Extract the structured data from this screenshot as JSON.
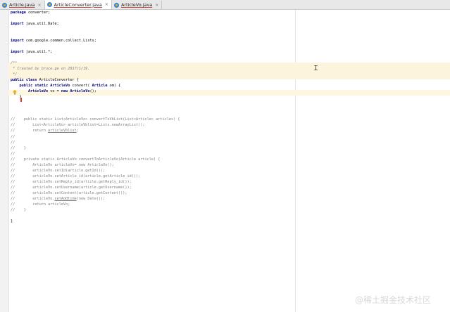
{
  "tabs": [
    {
      "label": "Article.java",
      "close": "×",
      "active": false
    },
    {
      "label": "ArticleConverter.java",
      "close": "×",
      "active": true
    },
    {
      "label": "ArticleVo.java",
      "close": "×",
      "active": false
    }
  ],
  "code": [
    [
      {
        "t": "package ",
        "c": "kw"
      },
      {
        "t": "converter;"
      }
    ],
    [],
    [
      {
        "t": "import ",
        "c": "kw"
      },
      {
        "t": "java.util.Date;"
      }
    ],
    [],
    [],
    [
      {
        "t": "import ",
        "c": "kw"
      },
      {
        "t": "com.google.common.collect.Lists;"
      }
    ],
    [],
    [
      {
        "t": "import ",
        "c": "kw"
      },
      {
        "t": "java.util.*;"
      }
    ],
    [],
    [
      {
        "t": "/**",
        "c": "ci"
      }
    ],
    [
      {
        "t": " * Created by bruce.ge on 2017/1/19.",
        "c": "ci"
      }
    ],
    [
      {
        "t": " */",
        "c": "ci"
      }
    ],
    [
      {
        "t": "public class ",
        "c": "kw"
      },
      {
        "t": "ArticleConverter {"
      }
    ],
    [
      {
        "t": "    "
      },
      {
        "t": "public static ",
        "c": "kw"
      },
      {
        "t": "ArticleVo ",
        "c": "kw"
      },
      {
        "t": "convert( "
      },
      {
        "t": "Article ",
        "c": "kw"
      },
      {
        "t": "om) {"
      }
    ],
    [
      {
        "t": "        "
      },
      {
        "t": "ArticleVo ",
        "c": "kw"
      },
      {
        "t": "vo = "
      },
      {
        "t": "new ",
        "c": "kw"
      },
      {
        "t": "ArticleVo",
        "c": "kw"
      },
      {
        "t": "();"
      }
    ],
    [
      {
        "t": "    }"
      }
    ],
    [],
    [],
    [],
    [
      {
        "t": "//    public static List<ArticleVo> convertToVbList(List<Article> articles) {",
        "c": "cm"
      }
    ],
    [
      {
        "t": "//        List<ArticleVo> articleVblist=Lists.newArrayList();",
        "c": "cm"
      }
    ],
    [
      {
        "t": "//        return ",
        "c": "cm"
      },
      {
        "t": "articleVblist",
        "c": "cm ul"
      },
      {
        "t": ";",
        "c": "cm"
      }
    ],
    [
      {
        "t": "//",
        "c": "cm"
      }
    ],
    [
      {
        "t": "//",
        "c": "cm"
      }
    ],
    [
      {
        "t": "//    }",
        "c": "cm"
      }
    ],
    [
      {
        "t": "//",
        "c": "cm"
      }
    ],
    [
      {
        "t": "//    private static ArticleVo convertToArticleVo(Article article) {",
        "c": "cm"
      }
    ],
    [
      {
        "t": "//        ArticleVo articleVo= new ArticleVo();",
        "c": "cm"
      }
    ],
    [
      {
        "t": "//        articleVo.setId(article.getId());",
        "c": "cm"
      }
    ],
    [
      {
        "t": "//        articleVo.setArticle_id(article.getArticle_id());",
        "c": "cm"
      }
    ],
    [
      {
        "t": "//        articleVo.setReply_id(article.getReply_id());",
        "c": "cm"
      }
    ],
    [
      {
        "t": "//        articleVo.setUsername(article.getUsername());",
        "c": "cm"
      }
    ],
    [
      {
        "t": "//        articleVo.setContent(article.getContent());",
        "c": "cm"
      }
    ],
    [
      {
        "t": "//        articleVo.",
        "c": "cm"
      },
      {
        "t": "setAddtime",
        "c": "cm ul"
      },
      {
        "t": "(new Date());",
        "c": "cm"
      }
    ],
    [
      {
        "t": "//        return articleVo;",
        "c": "cm"
      }
    ],
    [
      {
        "t": "//    }",
        "c": "cm"
      }
    ],
    [],
    [
      {
        "t": "}"
      }
    ]
  ],
  "watermark": "@稀土掘金技术社区",
  "icons": {
    "bulb": "lightbulb-icon",
    "ibeam": "text-cursor-icon",
    "file": "java-class-icon"
  },
  "colors": {
    "keyword": "#000080",
    "comment": "#808080",
    "current_line": "#fdf6e0",
    "comment_block": "#fcf4dc"
  }
}
